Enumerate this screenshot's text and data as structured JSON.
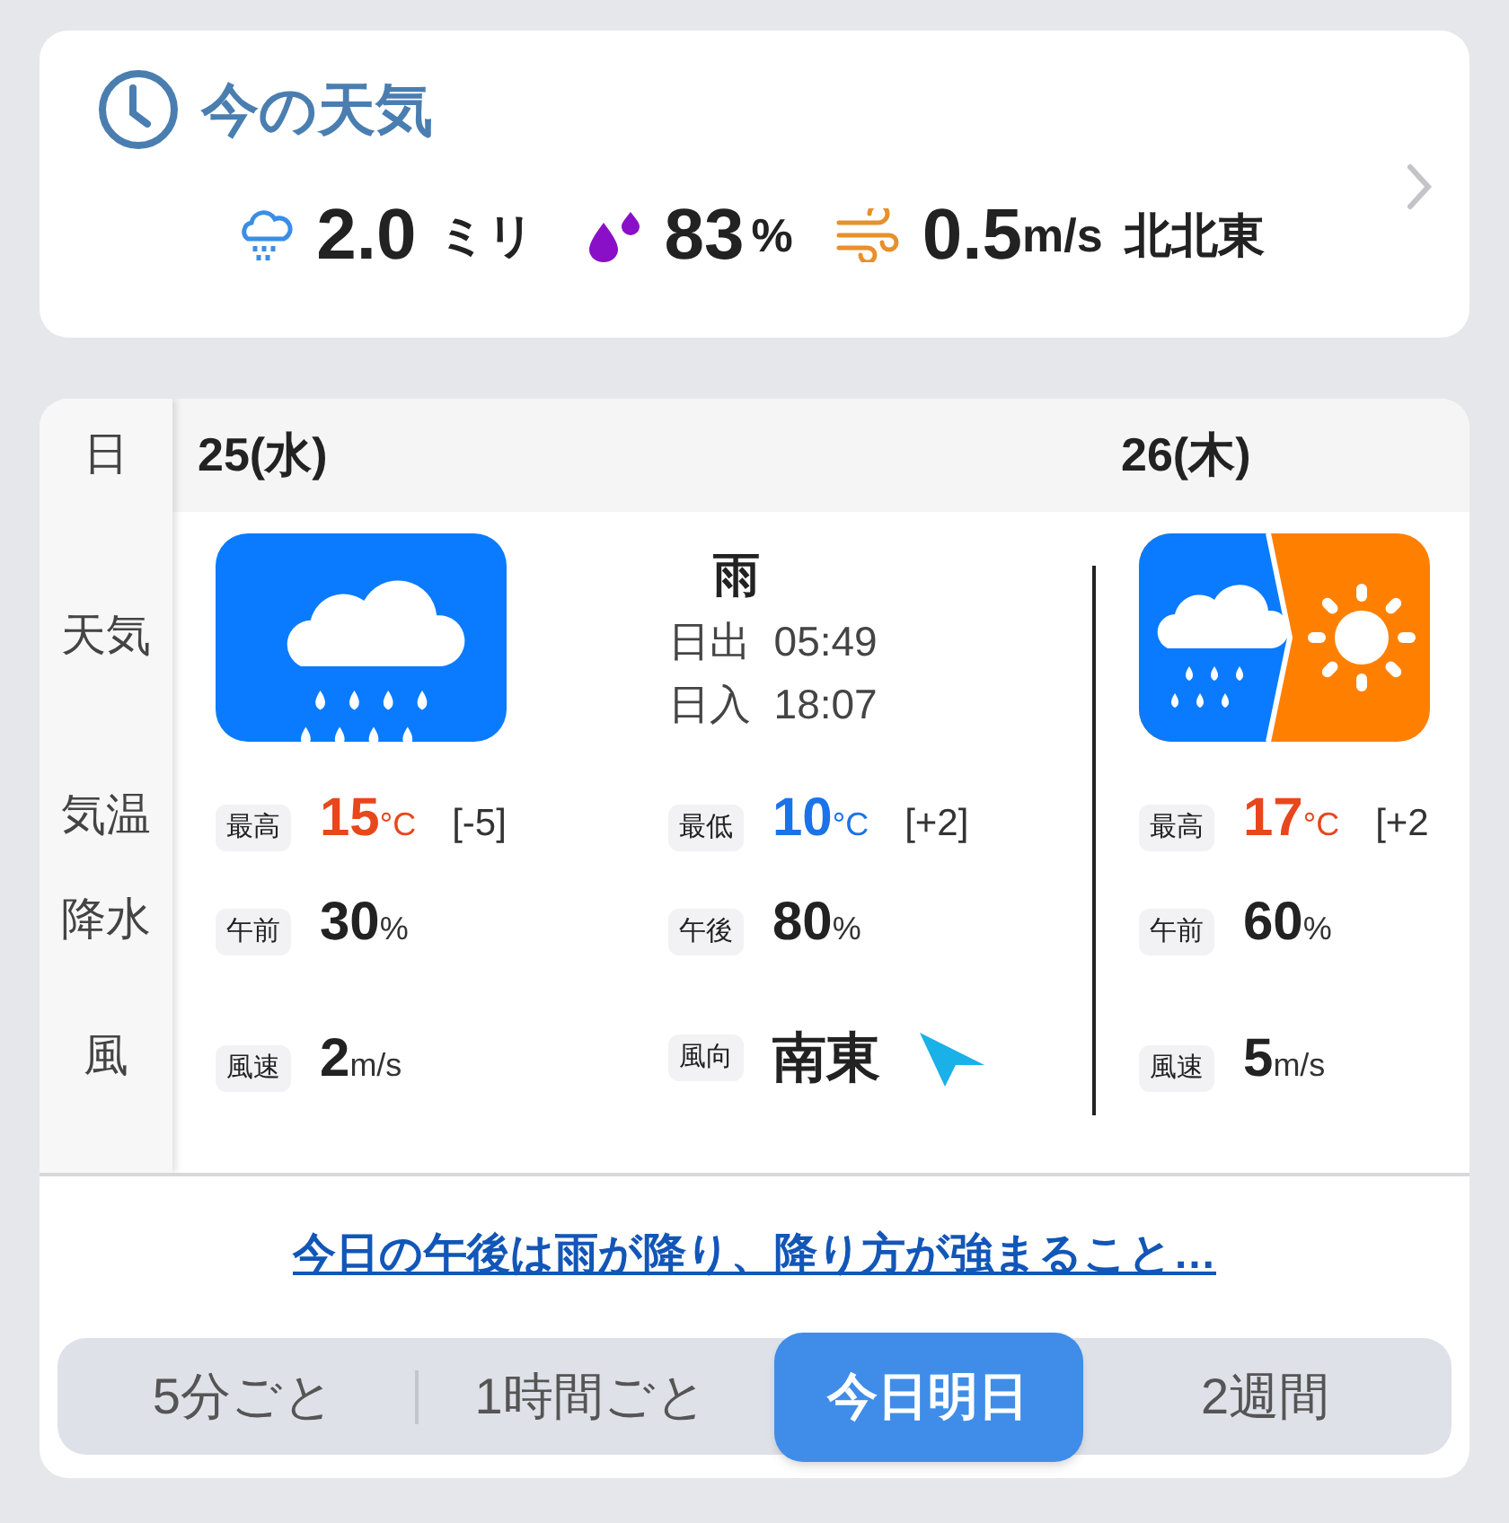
{
  "now": {
    "title": "今の天気",
    "precipitation": {
      "value": "2.0",
      "unit": "ミリ"
    },
    "humidity": {
      "value": "83",
      "unit": "%"
    },
    "wind": {
      "value": "0.5",
      "unit": "m/s",
      "direction": "北北東"
    }
  },
  "row_labels": [
    "日",
    "天気",
    "気温",
    "降水",
    "風"
  ],
  "days": [
    {
      "date": "25(水)",
      "weather": {
        "kind": "rain"
      },
      "weather_text": "雨",
      "sunrise": {
        "label": "日出",
        "time": "05:49"
      },
      "sunset": {
        "label": "日入",
        "time": "18:07"
      },
      "high": {
        "label": "最高",
        "value": "15",
        "unit": "°C",
        "diff": "[-5]"
      },
      "low": {
        "label": "最低",
        "value": "10",
        "unit": "°C",
        "diff": "[+2]"
      },
      "precip": [
        {
          "label": "午前",
          "value": "30",
          "unit": "%"
        },
        {
          "label": "午後",
          "value": "80",
          "unit": "%"
        }
      ],
      "wind_speed": {
        "label": "風速",
        "value": "2",
        "unit": "m/s"
      },
      "wind_direction": {
        "label": "風向",
        "value": "南東"
      }
    },
    {
      "date": "26(木)",
      "weather": {
        "kind": "rain_then_sun"
      },
      "high": {
        "label": "最高",
        "value": "17",
        "unit": "°C",
        "diff": "[+2"
      },
      "precip": [
        {
          "label": "午前",
          "value": "60",
          "unit": "%"
        }
      ],
      "wind_speed": {
        "label": "風速",
        "value": "5",
        "unit": "m/s"
      }
    }
  ],
  "summary_link": "今日の午後は雨が降り、降り方が強まること…",
  "tabs": [
    {
      "label": "5分ごと",
      "selected": false
    },
    {
      "label": "1時間ごと",
      "selected": false
    },
    {
      "label": "今日明日",
      "selected": true
    },
    {
      "label": "2週間",
      "selected": false
    }
  ]
}
